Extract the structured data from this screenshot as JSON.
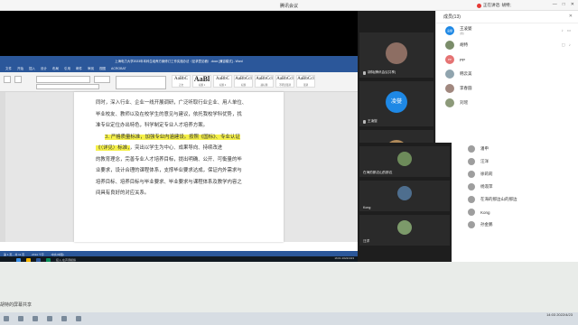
{
  "meeting": {
    "title": "腾讯会议",
    "sharing_text": "正在讲话: 胡特;",
    "controls": [
      "—",
      "□",
      "✕"
    ]
  },
  "word": {
    "title": "上海电力大学2023年本科生培养方案修订工作实施办法（征求意见稿）.docx [兼容模式] - Word",
    "menus": [
      "文件",
      "开始",
      "插入",
      "设计",
      "布局",
      "引用",
      "邮件",
      "审阅",
      "视图",
      "ACROBAT"
    ],
    "styles": [
      {
        "sample": "AaBbC",
        "name": "正文"
      },
      {
        "sample": "AaBl",
        "name": "标题 1"
      },
      {
        "sample": "AaBbC",
        "name": "标题 2"
      },
      {
        "sample": "AaBbCcl",
        "name": "标题"
      },
      {
        "sample": "AaBbCcl",
        "name": "副标题"
      },
      {
        "sample": "AaBbCcl",
        "name": "不明显强调"
      },
      {
        "sample": "AaBbCcl",
        "name": "强调"
      }
    ],
    "doc_lines": [
      "同时，深入行业、企业一线开展调研，广泛听取行业企业、用人单位、",
      "毕业校友、教师以及在校学生的意见与建议，依托我校学科优势，找",
      "准专业定位办出特色，科学制定专业人才培养方案。",
      "3. 严格质量标准，加强专业内涵建设。按照《国标》、专业认证",
      "《（详见）标准，",
      "的教育理念，完善专业人才培养目标，提出明确、公开、可衡量的毕",
      "业要求，设计合理的课程体系，支撑毕业要求达成，保证内外需求与",
      "培养目标、培养目标与毕业要求、毕业要求与课程体系及教学内容之",
      "间具有良好的对应关系。"
    ],
    "line5_tail": "，突出以学生为中心、成果导向、持续改进",
    "status": [
      "第 1 页，共 11 页",
      "2724 个字",
      "中文(中国)"
    ]
  },
  "inner_taskbar": {
    "task_label": "接入·在声调模拟",
    "clock": "16:01 2022/4/23"
  },
  "videos": [
    {
      "label": "胡特(腾讯会议共享)",
      "avatar": ""
    },
    {
      "label": "王凌燮",
      "avatar": "凌燮"
    },
    {
      "label": "在海的那边山的那边",
      "avatar": ""
    }
  ],
  "overlay_videos": [
    {
      "label": "在海的那边山的那边"
    },
    {
      "label": "Kong"
    },
    {
      "label": "汪洋"
    }
  ],
  "participants": {
    "header": "成员(13)",
    "list": [
      {
        "name": "王凌燮",
        "sub": "(我)",
        "av": "凌燮"
      },
      {
        "name": "胡特",
        "sub": "",
        "av": ""
      },
      {
        "name": "PP",
        "sub": "",
        "av": "PP"
      },
      {
        "name": "韩云美",
        "sub": "",
        "av": ""
      },
      {
        "name": "李春圆",
        "sub": "",
        "av": ""
      },
      {
        "name": "刘瑶",
        "sub": "",
        "av": ""
      }
    ]
  },
  "overlay_list": [
    "潘申",
    "汪洋",
    "徐莉莉",
    "杨淑萍",
    "在海的那边山的那边",
    "Kong",
    "孙金鹏"
  ],
  "desktop": {
    "left_label": "胡特的屏幕共享",
    "clock": "14:03 2022/4/23"
  }
}
